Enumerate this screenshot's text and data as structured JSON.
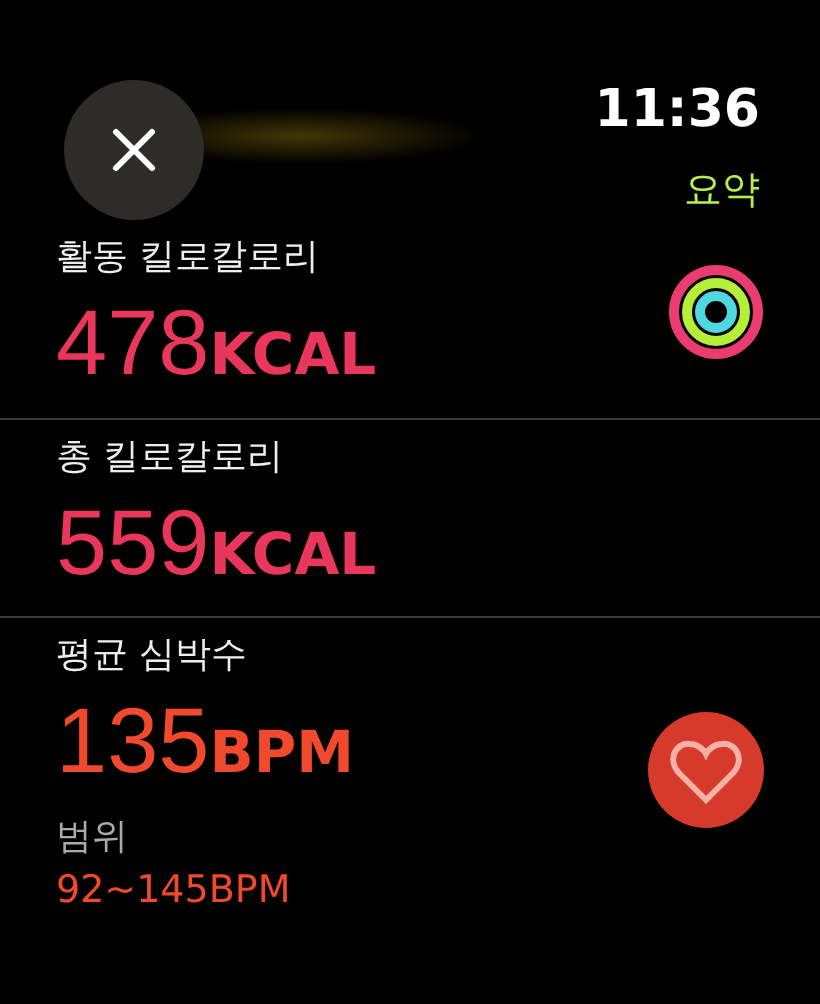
{
  "header": {
    "time": "11:36",
    "title": "요약"
  },
  "metrics": [
    {
      "label": "활동 킬로칼로리",
      "number": "478",
      "unit": "KCAL",
      "color": "#e8375a",
      "kind": "activity"
    },
    {
      "label": "총 킬로칼로리",
      "number": "559",
      "unit": "KCAL",
      "color": "#e8375a",
      "kind": "total"
    },
    {
      "label": "평균 심박수",
      "number": "135",
      "unit": "BPM",
      "color": "#f0492d",
      "kind": "heart",
      "range_label": "범위",
      "range_value": "92~145BPM"
    }
  ]
}
